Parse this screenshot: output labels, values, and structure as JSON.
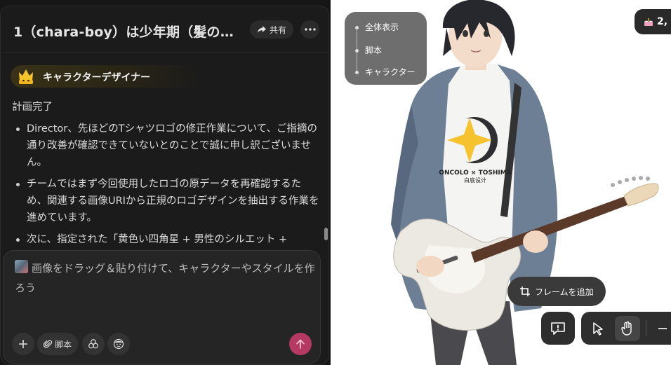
{
  "chat": {
    "title": "1（chara-boy）は少年期（髪の…",
    "share_label": "共有",
    "agent_name": "キャラクターデザイナー",
    "message": {
      "heading": "計画完了",
      "bullets": [
        "Director、先ほどのTシャツロゴの修正作業について、ご指摘の通り改善が確認できていないとのことで誠に申し訳ございません。",
        "チームではまず今回使用したロゴの原データを再確認するため、関連する画像URIから正規のロゴデザインを抽出する作業を進めています。",
        "次に、指定された「黄色い四角星 + 男性のシルエット +"
      ]
    },
    "input": {
      "placeholder": "画像をドラッグ＆貼り付けて、キャラクターやスタイルを作ろう",
      "tools": {
        "script_label": "脚本"
      }
    }
  },
  "canvas": {
    "view_nav": [
      "全体表示",
      "脚本",
      "キャラクター"
    ],
    "credits": "2,",
    "add_frame_label": "フレームを追加",
    "shirt_logo_text": "ONCOLO × TOSHIMA",
    "shirt_logo_sub": "白底设计"
  },
  "colors": {
    "accent": "#b43a63",
    "panel": "#1b1b1b"
  }
}
